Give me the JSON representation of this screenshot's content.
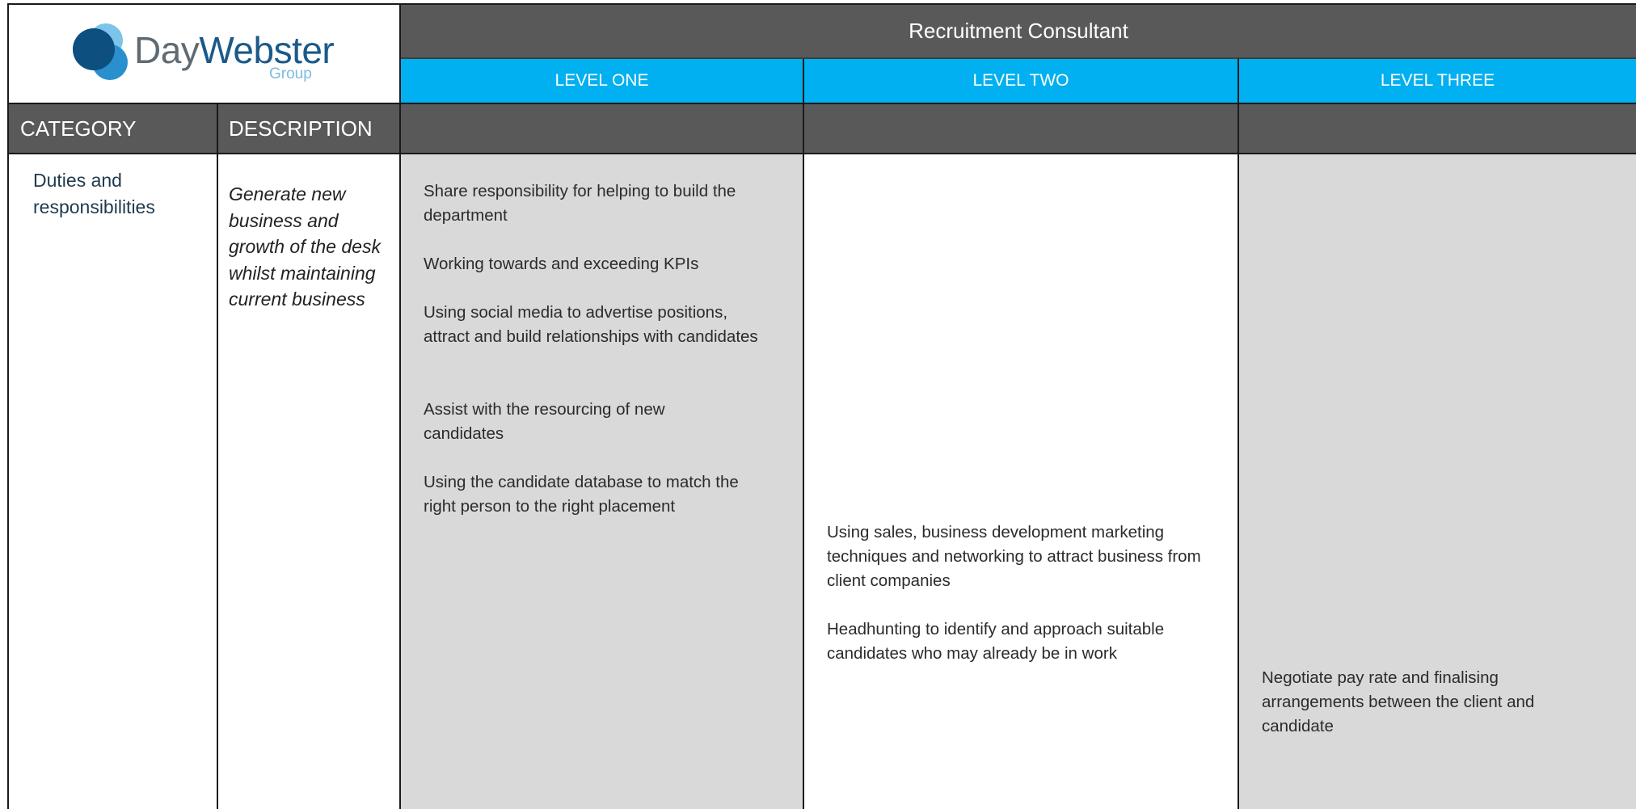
{
  "logo": {
    "word_day": "Day",
    "word_webster": "Webster",
    "word_group": "Group",
    "colors": {
      "dark": "#0d4f7f",
      "mid": "#2a8fcf",
      "light": "#7cc4ea"
    }
  },
  "header": {
    "role_title": "Recruitment Consultant",
    "levels": [
      "LEVEL ONE",
      "LEVEL TWO",
      "LEVEL THREE"
    ],
    "category_label": "CATEGORY",
    "description_label": "DESCRIPTION"
  },
  "row": {
    "category": "Duties and responsibilities",
    "description": "Generate new business and growth of the desk whilst maintaining current business",
    "level_one": [
      "Share responsibility for helping to build the department",
      "Working towards and exceeding KPIs",
      "Using social media to advertise positions, attract and build relationships with candidates",
      "Assist with the resourcing of new candidates",
      "Using the candidate database to match the right person to the right placement"
    ],
    "level_two": [
      "Using sales, business development marketing techniques and networking to attract business from client companies",
      "Headhunting to identify and approach suitable candidates who may already be in work"
    ],
    "level_three": [
      "Negotiate pay rate and finalising arrangements between the client and candidate"
    ]
  },
  "colors": {
    "header_grey": "#595959",
    "level_blue": "#00b0f0",
    "cell_grey": "#d9d9d9"
  }
}
